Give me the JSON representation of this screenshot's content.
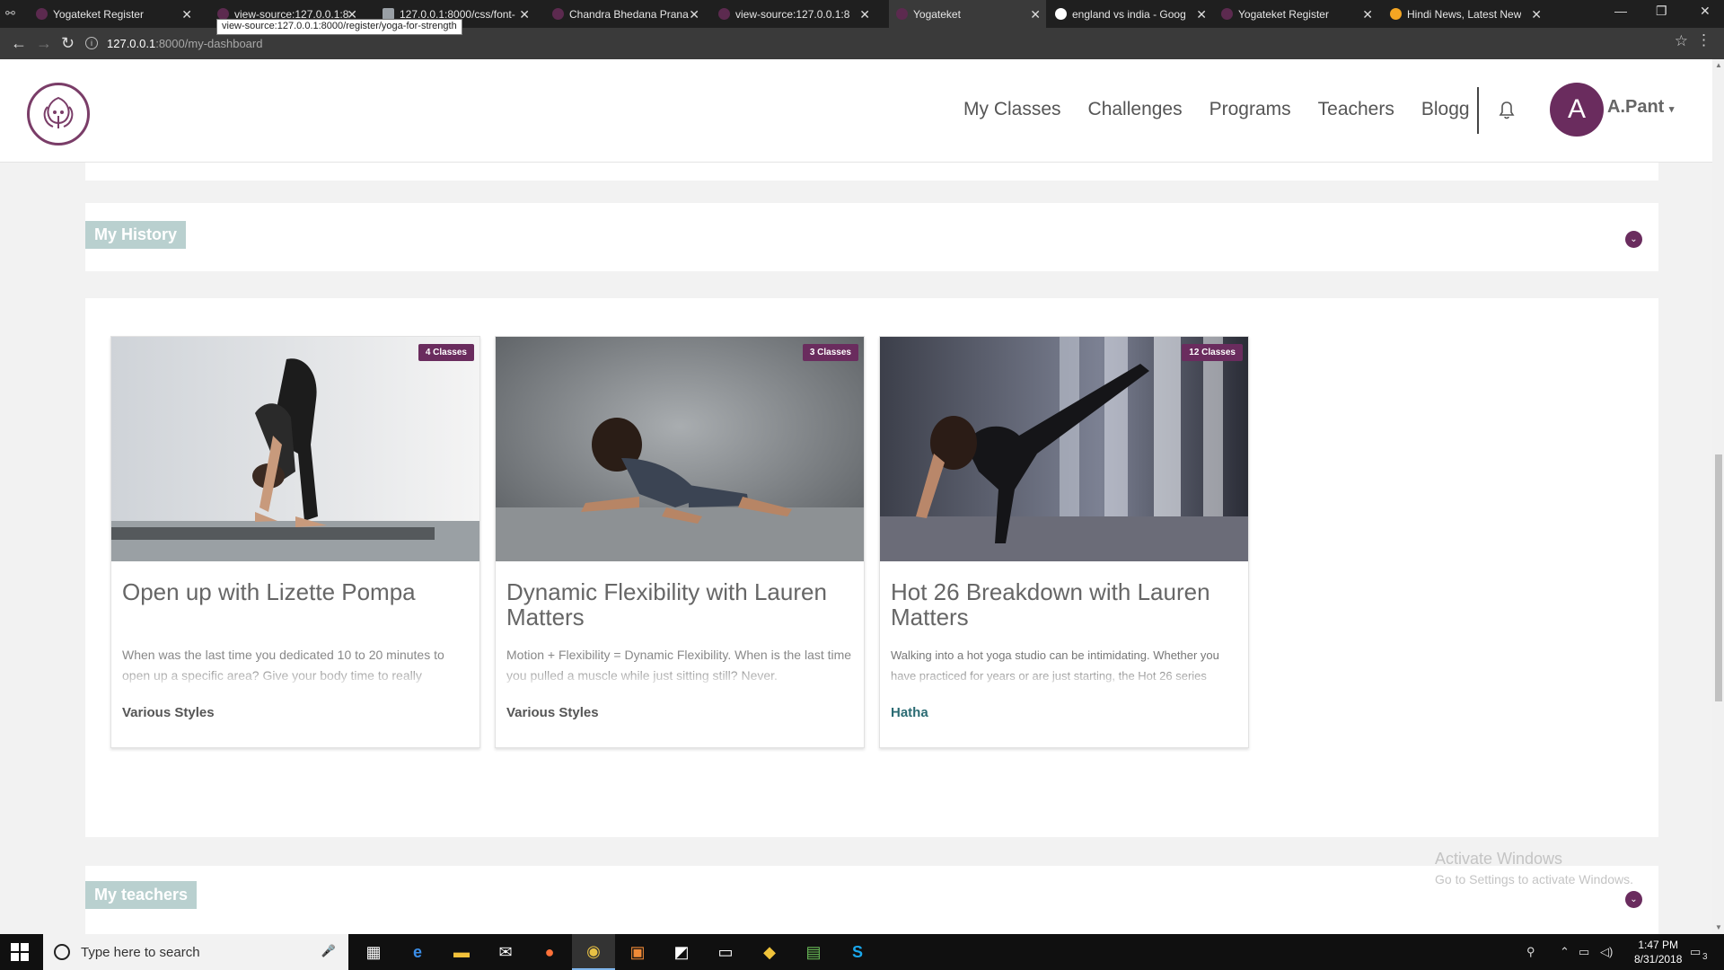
{
  "browser": {
    "tabs": [
      {
        "title": "Yogateket Register",
        "favicon_color": "#5c2a4f"
      },
      {
        "title": "view-source:127.0.0.1:8",
        "favicon_color": "#5c2a4f"
      },
      {
        "title": "127.0.0.1:8000/css/font-",
        "favicon_color": "#9aa0a6"
      },
      {
        "title": "Chandra Bhedana Prana",
        "favicon_color": "#5c2a4f"
      },
      {
        "title": "view-source:127.0.0.1:8",
        "favicon_color": "#5c2a4f"
      },
      {
        "title": "Yogateket",
        "favicon_color": "#5c2a4f"
      },
      {
        "title": "england vs india - Goog",
        "favicon_color": "#ffffff"
      },
      {
        "title": "Yogateket Register",
        "favicon_color": "#5c2a4f"
      },
      {
        "title": "Hindi News, Latest New",
        "favicon_color": "#f5a623"
      }
    ],
    "active_tab_index": 5,
    "tooltip": "view-source:127.0.0.1:8000/register/yoga-for-strength",
    "url_host": "127.0.0.1",
    "url_path": ":8000/my-dashboard"
  },
  "header": {
    "nav": [
      "My Classes",
      "Challenges",
      "Programs",
      "Teachers",
      "Blogg"
    ],
    "avatar_initial": "A",
    "username": "A.Pant",
    "brand_color": "#6a2c5e"
  },
  "history": {
    "label": "My History"
  },
  "cards": [
    {
      "badge": "4 Classes",
      "title": "Open up with Lizette Pompa",
      "desc": "When was the last time you dedicated 10 to 20 minutes to open up a specific area? Give your body time to really",
      "style": "Various Styles"
    },
    {
      "badge": "3 Classes",
      "title": "Dynamic Flexibility with Lauren Matters",
      "desc": "Motion + Flexibility = Dynamic Flexibility. When is the last time you pulled a muscle while just sitting still? Never.",
      "style": "Various Styles"
    },
    {
      "badge": "12 Classes",
      "title": "Hot 26 Breakdown with Lauren Matters",
      "desc": "Walking into a hot yoga studio can be intimidating. Whether you have practiced for years or are just starting, the Hot 26 series",
      "style": "Hatha"
    }
  ],
  "teachers": {
    "label": "My teachers"
  },
  "watermark": {
    "line1": "Activate Windows",
    "line2": "Go to Settings to activate Windows."
  },
  "taskbar": {
    "search_placeholder": "Type here to search",
    "time": "1:47 PM",
    "date": "8/31/2018",
    "notifications": "3"
  }
}
